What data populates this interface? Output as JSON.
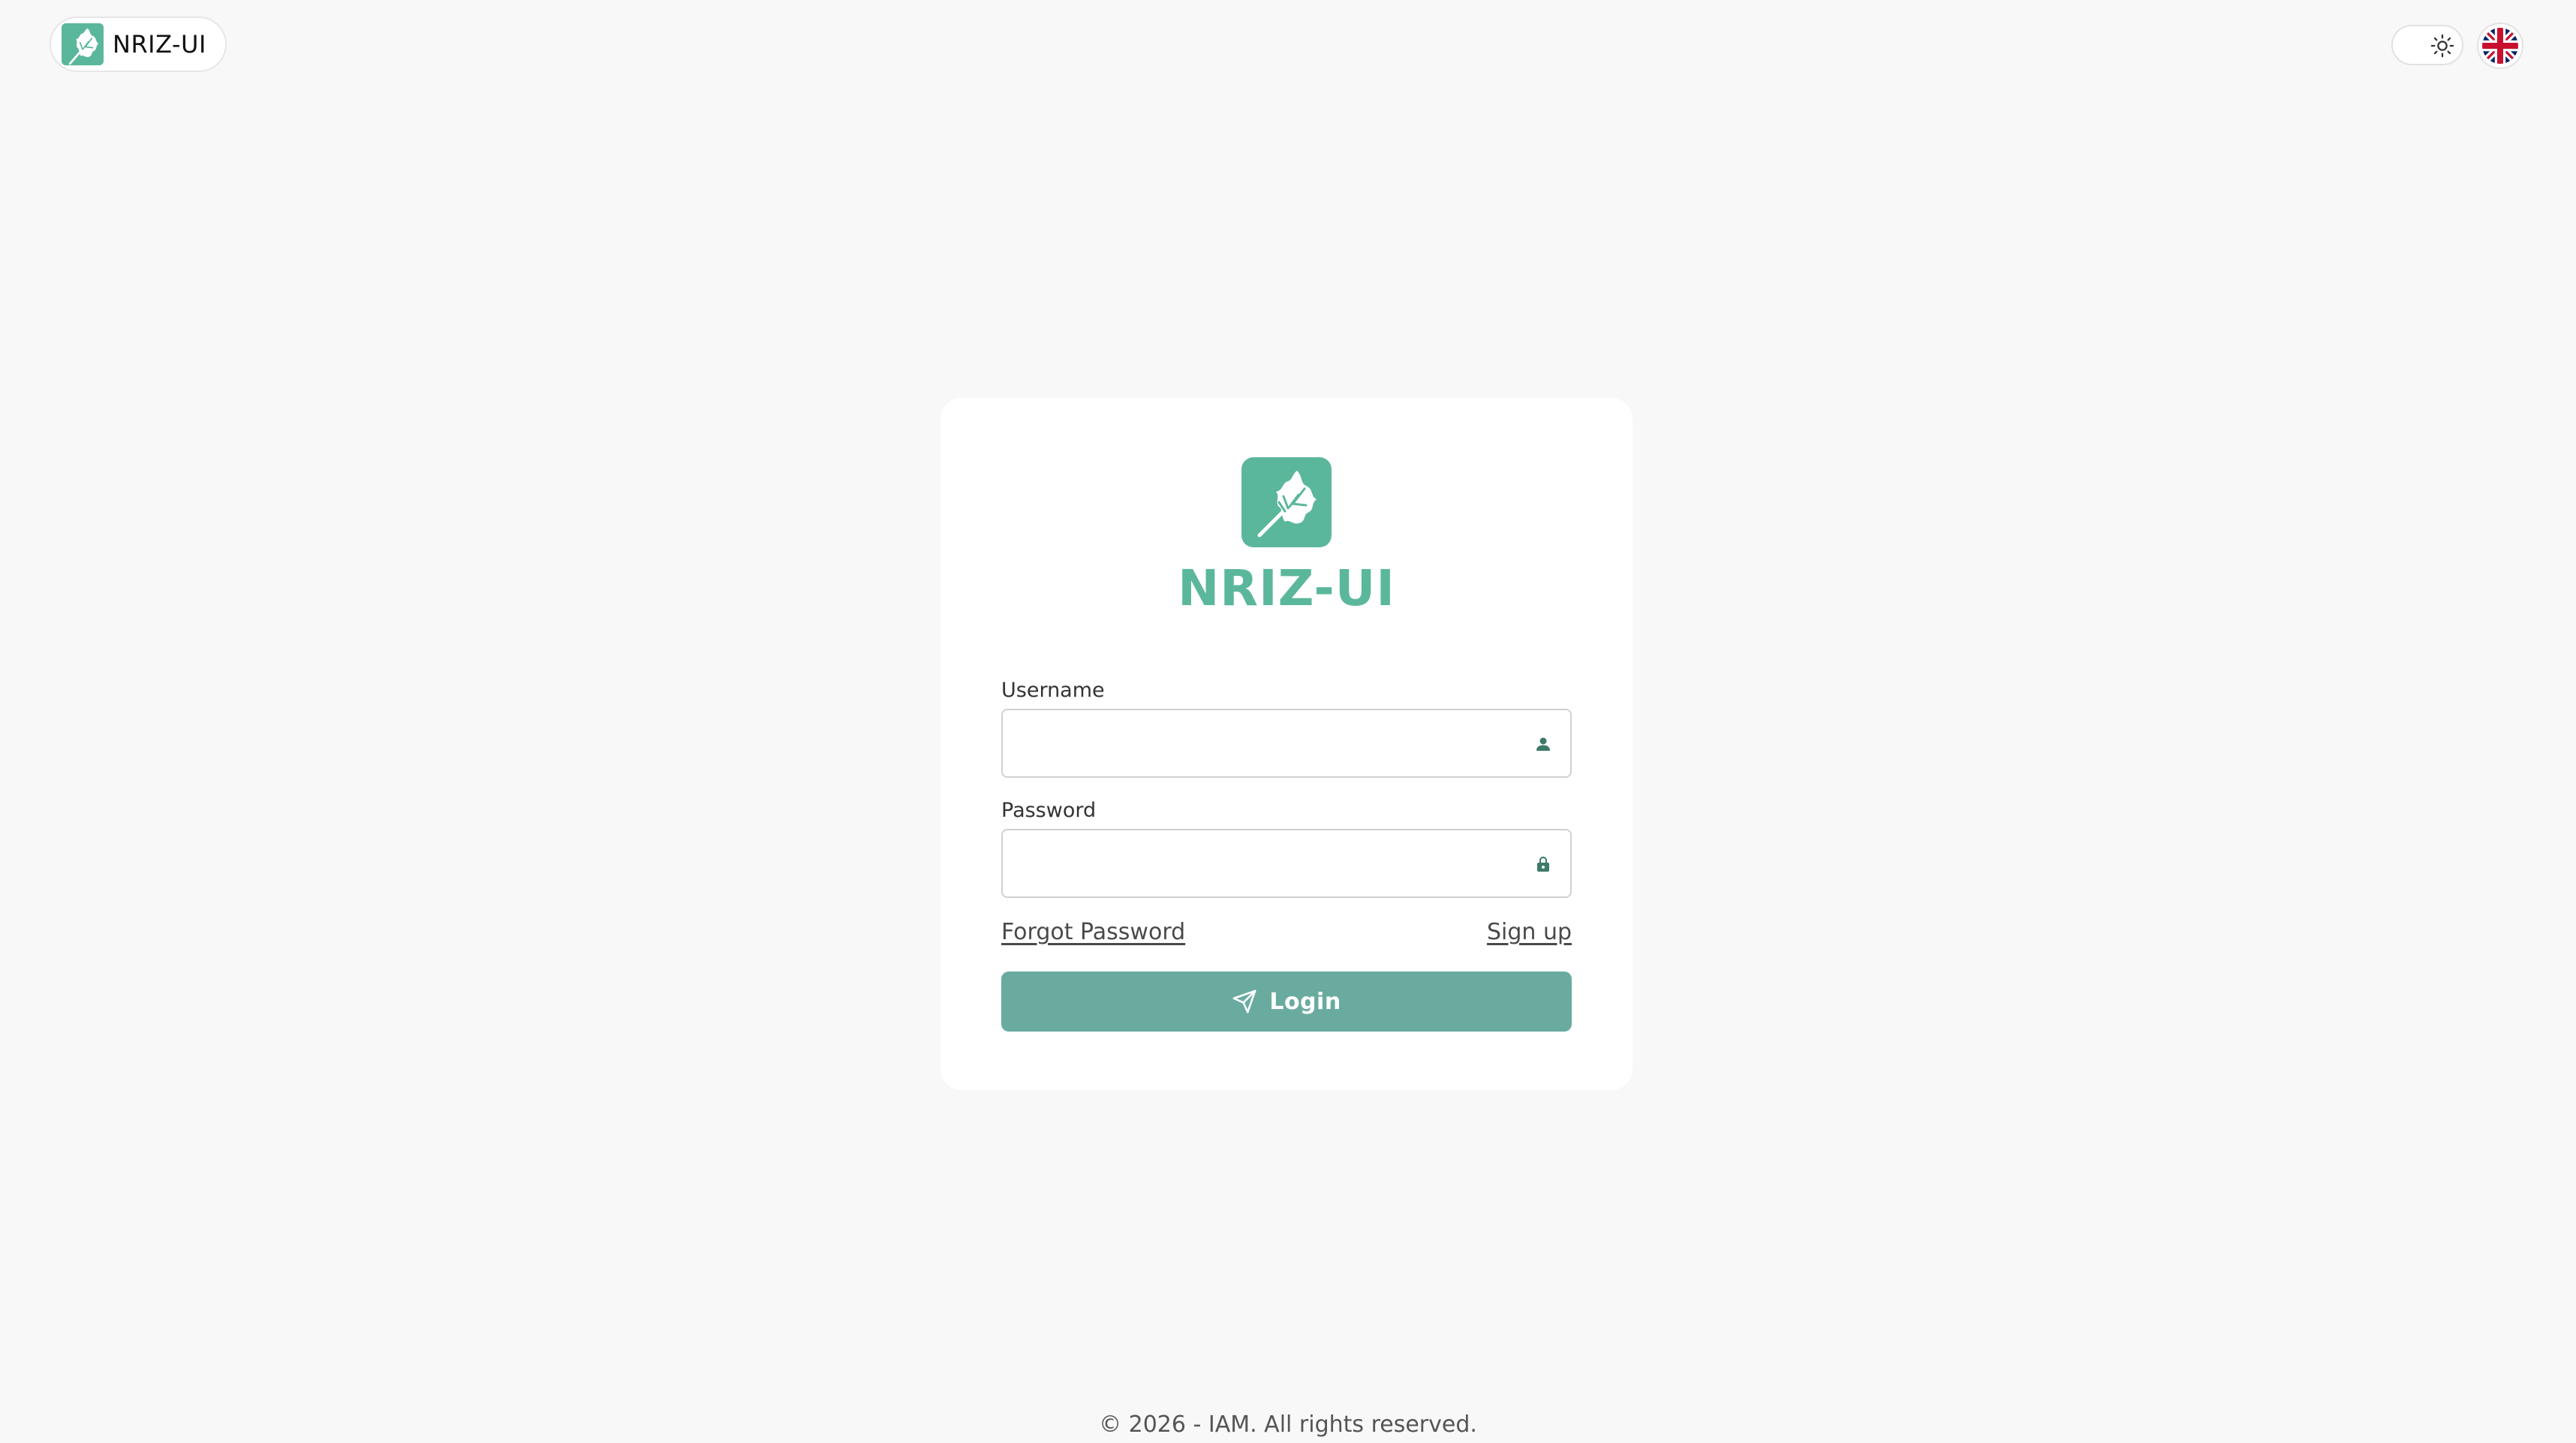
{
  "header": {
    "brand_name": "NRIZ-UI",
    "brand_icon": "oak-leaf-icon",
    "theme_toggle_icon": "sun-icon",
    "language_icon": "uk-flag-icon"
  },
  "login": {
    "logo_icon": "oak-leaf-icon",
    "title": "NRIZ-UI",
    "username_label": "Username",
    "username_value": "",
    "username_icon": "user-icon",
    "password_label": "Password",
    "password_value": "",
    "password_icon": "lock-icon",
    "forgot_password_label": "Forgot Password",
    "signup_label": "Sign up",
    "login_label": "Login",
    "login_icon": "send-icon"
  },
  "footer": {
    "copyright": "© 2026 - IAM. All rights reserved."
  },
  "colors": {
    "background": "#f8f8f8",
    "brand_green": "#5bb79c",
    "login_button": "#6aaba0",
    "card": "#ffffff"
  }
}
